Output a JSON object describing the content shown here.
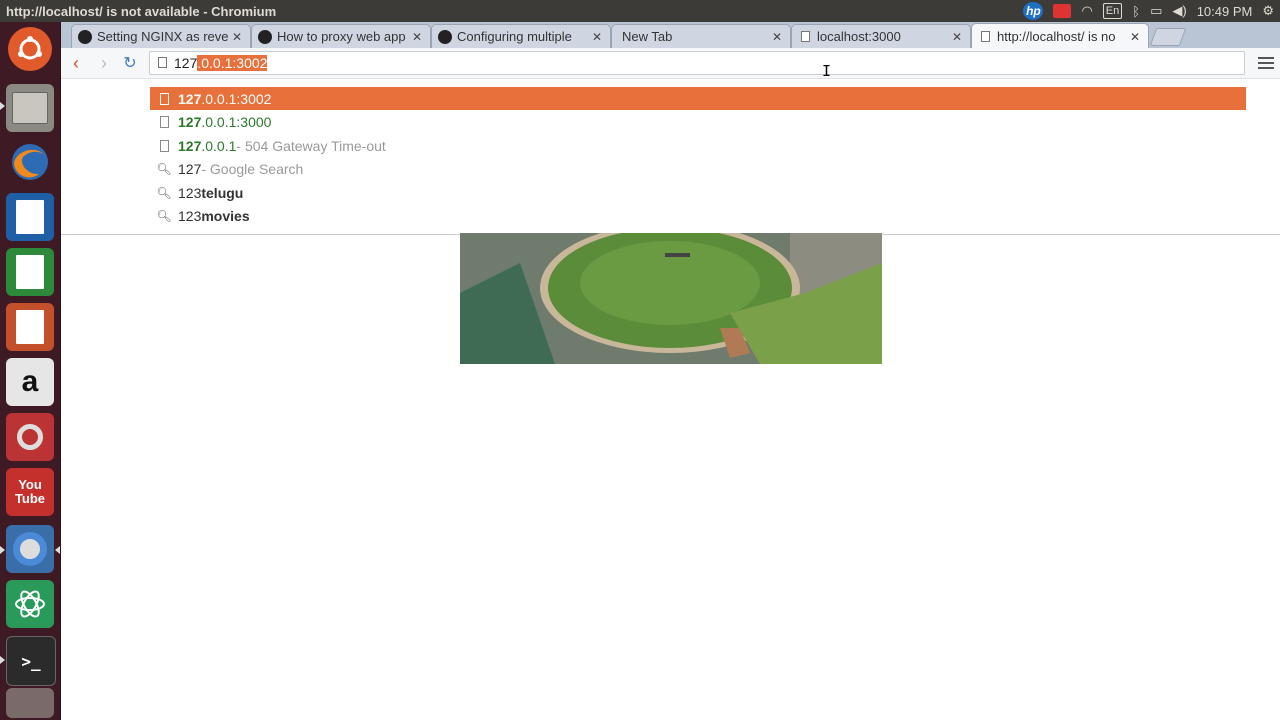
{
  "window": {
    "title": "http://localhost/ is not available - Chromium"
  },
  "panel": {
    "time": "10:49 PM",
    "keyboard": "En"
  },
  "launcher": {
    "items": [
      {
        "name": "ubuntu-dash-icon"
      },
      {
        "name": "files-icon"
      },
      {
        "name": "firefox-icon"
      },
      {
        "name": "writer-icon"
      },
      {
        "name": "calc-icon"
      },
      {
        "name": "impress-icon"
      },
      {
        "name": "amazon-icon"
      },
      {
        "name": "system-settings-icon"
      },
      {
        "name": "youtube-icon",
        "label_top": "You",
        "label_bottom": "Tube"
      },
      {
        "name": "chromium-icon"
      },
      {
        "name": "atom-icon"
      },
      {
        "name": "terminal-icon"
      },
      {
        "name": "trash-icon"
      }
    ]
  },
  "tabs": [
    {
      "label": "Setting NGINX as reve",
      "icon": "github-icon"
    },
    {
      "label": "How to proxy web app",
      "icon": "github-icon"
    },
    {
      "label": "Configuring multiple",
      "icon": "github-icon"
    },
    {
      "label": "New Tab",
      "icon": ""
    },
    {
      "label": "localhost:3000",
      "icon": "page-icon"
    },
    {
      "label": "http://localhost/ is no",
      "icon": "page-icon"
    }
  ],
  "omnibox": {
    "typed": "127",
    "autocompleted": ".0.0.1:3002"
  },
  "suggestions": [
    {
      "type": "url",
      "match": "127",
      "rest": ".0.0.1:3002",
      "desc": ""
    },
    {
      "type": "url",
      "match": "127",
      "rest": ".0.0.1:3000",
      "desc": ""
    },
    {
      "type": "url",
      "match": "127",
      "rest": ".0.0.1",
      "desc": " - 504 Gateway Time-out"
    },
    {
      "type": "search",
      "match": "127",
      "rest": "",
      "desc": " - Google Search"
    },
    {
      "type": "search",
      "match": "123",
      "rest": "telugu",
      "desc": ""
    },
    {
      "type": "search",
      "match": "123",
      "rest": "movies",
      "desc": ""
    }
  ],
  "colors": {
    "accent": "#e8703a",
    "launcher_bg": "#3e1b24",
    "panel_bg": "#3c3b37"
  }
}
